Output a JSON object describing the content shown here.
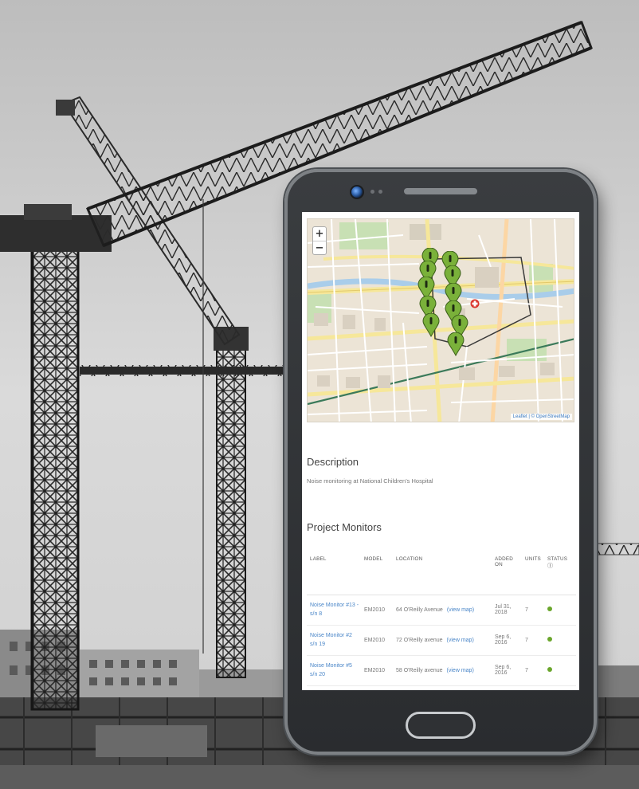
{
  "map": {
    "zoom_in": "+",
    "zoom_out": "−",
    "attribution": "Leaflet | © OpenStreetMap",
    "marker_color": "#7ab13a",
    "poi_color": "#d9342b"
  },
  "description": {
    "heading": "Description",
    "text": "Noise monitoring at National Children's Hospital"
  },
  "monitors": {
    "heading": "Project Monitors",
    "columns": [
      "LABEL",
      "MODEL",
      "LOCATION",
      "ADDED ON",
      "UNITS",
      "STATUS"
    ],
    "rows": [
      {
        "label": "Noise Monitor #13 - s/n 8",
        "model": "EM2010",
        "location": "64 O'Reilly Avenue",
        "view_map": "(view map)",
        "added": "Jul 31, 2018",
        "units": "7",
        "status": "ok"
      },
      {
        "label": "Noise Monitor #2 s/n 19",
        "model": "EM2010",
        "location": "72 O'Reilly avenue",
        "view_map": "(view map)",
        "added": "Sep 6, 2016",
        "units": "7",
        "status": "ok"
      },
      {
        "label": "Noise Monitor #5 s/n 20",
        "model": "EM2010",
        "location": "58 O'Reilly avenue",
        "view_map": "(view map)",
        "added": "Sep 6, 2016",
        "units": "7",
        "status": "ok"
      }
    ],
    "status_color": "#6aa62c"
  }
}
